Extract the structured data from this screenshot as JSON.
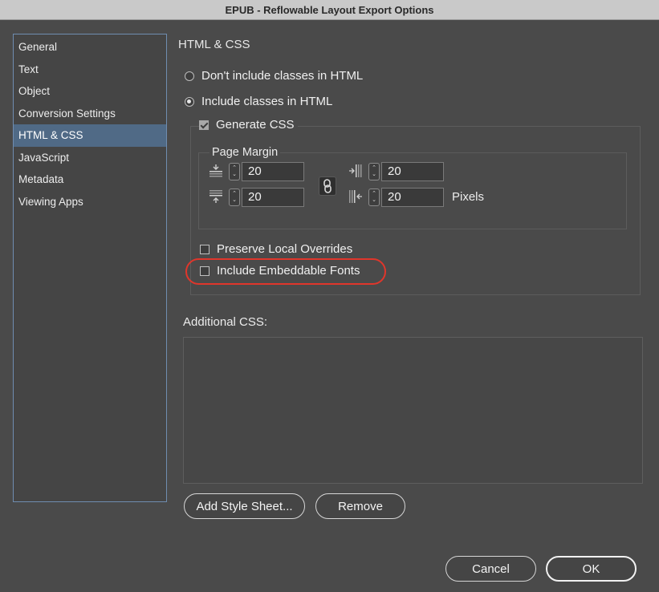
{
  "window": {
    "title": "EPUB - Reflowable Layout Export Options"
  },
  "sidebar": {
    "items": [
      {
        "label": "General",
        "active": false
      },
      {
        "label": "Text",
        "active": false
      },
      {
        "label": "Object",
        "active": false
      },
      {
        "label": "Conversion Settings",
        "active": false
      },
      {
        "label": "HTML & CSS",
        "active": true
      },
      {
        "label": "JavaScript",
        "active": false
      },
      {
        "label": "Metadata",
        "active": false
      },
      {
        "label": "Viewing Apps",
        "active": false
      }
    ]
  },
  "panel": {
    "title": "HTML & CSS",
    "radio_no_classes": {
      "label": "Don't include classes in HTML",
      "selected": false
    },
    "radio_classes": {
      "label": "Include classes in HTML",
      "selected": true
    },
    "generate_css": {
      "label": "Generate CSS",
      "checked": true
    },
    "page_margin": {
      "label": "Page Margin",
      "top": "20",
      "bottom": "20",
      "left": "20",
      "right": "20",
      "units": "Pixels",
      "link_icon": "chain-link-icon"
    },
    "preserve_overrides": {
      "label": "Preserve Local Overrides",
      "checked": false
    },
    "embed_fonts": {
      "label": "Include Embeddable Fonts",
      "checked": false,
      "highlight_color": "#e0362b"
    },
    "additional_css_label": "Additional CSS:",
    "add_stylesheet_button": "Add Style Sheet...",
    "remove_button": "Remove"
  },
  "footer": {
    "cancel": "Cancel",
    "ok": "OK"
  },
  "colors": {
    "background": "#4a4a4a",
    "sidebar_active": "#506a86",
    "sidebar_border": "#6f8db0",
    "titlebar": "#c9c9c9"
  }
}
